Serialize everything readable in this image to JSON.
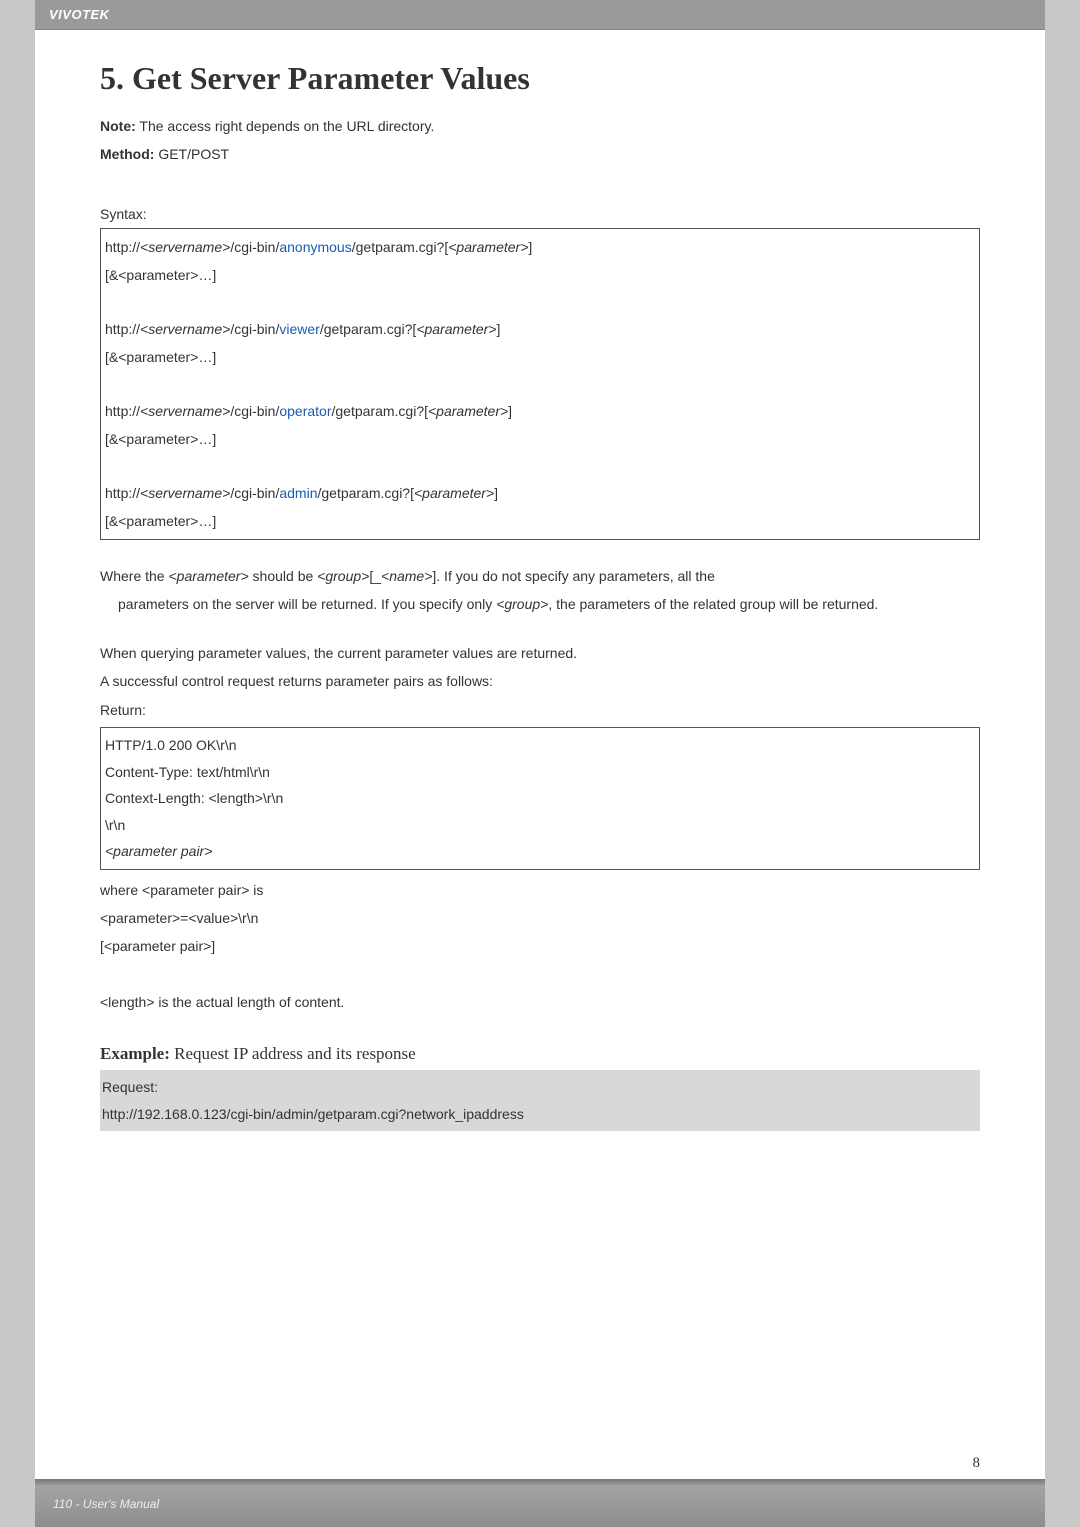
{
  "header": {
    "brand": "VIVOTEK"
  },
  "title": "5. Get Server Parameter Values",
  "note_label": "Note:",
  "note_text": " The access right depends on the URL directory.",
  "method_label": "Method:",
  "method_text": " GET/POST",
  "syntax_label": "Syntax:",
  "syntax": {
    "line1_a": "http://",
    "line1_b": "<servername>",
    "line1_c": "/cgi-bin/",
    "role1": "anonymous",
    "line1_d": "/getparam.cgi?[",
    "line1_e": "<parameter>",
    "line1_f": "]",
    "line2": "[&<parameter>…]",
    "role2": "viewer",
    "role3": "operator",
    "role4": "admin"
  },
  "desc1_a": "Where the ",
  "desc1_b": "<parameter>",
  "desc1_c": " should be ",
  "desc1_d": "<group>",
  "desc1_e": "[_",
  "desc1_f": "<name>",
  "desc1_g": "]. If you do not specify any parameters, all the ",
  "desc1_h": "parameters on the server will be returned. If you specify only ",
  "desc1_i": "<group>",
  "desc1_j": ", the parameters of the related group will be returned.",
  "desc2": "When querying parameter values, the current parameter values are returned.",
  "desc3": "A successful control request returns parameter pairs as follows:",
  "return_label": "Return:",
  "return_box": {
    "l1": "HTTP/1.0 200 OK\\r\\n",
    "l2": "Content-Type: text/html\\r\\n",
    "l3": "Context-Length: <length>\\r\\n",
    "l4": "\\r\\n",
    "l5": "<parameter pair>"
  },
  "after": {
    "l1": "where <parameter pair> is",
    "l2": "<parameter>=<value>\\r\\n",
    "l3": "[<parameter pair>]",
    "l4": "<length> is the actual length of content."
  },
  "example_label": "Example:",
  "example_text": " Request IP address and its response",
  "example_box": {
    "l1": "Request:",
    "l2": "http://192.168.0.123/cgi-bin/admin/getparam.cgi?network_ipaddress"
  },
  "page_num": "8",
  "footer_text": "110 - User's Manual"
}
